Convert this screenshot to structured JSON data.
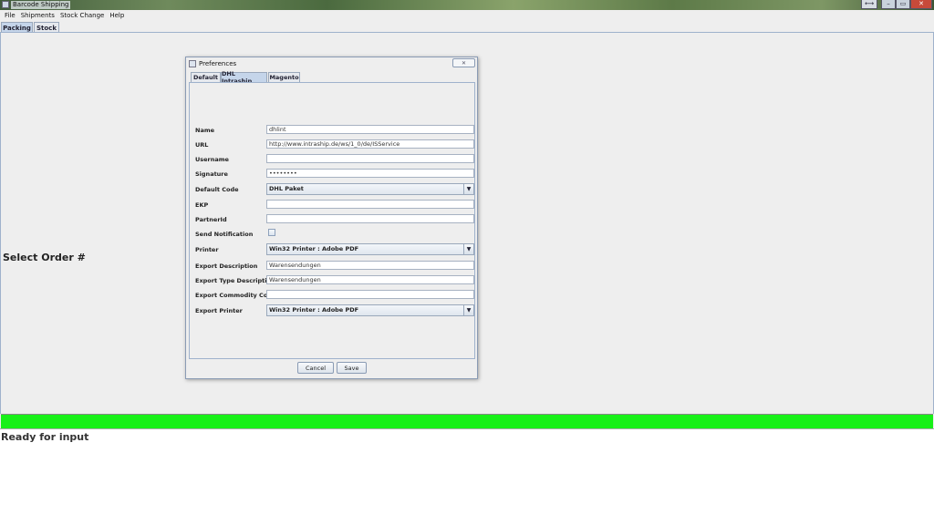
{
  "window": {
    "title": "Barcode Shipping",
    "controls": {
      "resize": "⟷",
      "minimize": "–",
      "maximize": "▭",
      "close": "✕"
    }
  },
  "menu": {
    "items": [
      "File",
      "Shipments",
      "Stock Change",
      "Help"
    ]
  },
  "tabs": {
    "packing": "Packing",
    "stock": "Stock"
  },
  "main": {
    "select_order_label": "Select Order #"
  },
  "status": {
    "text": "Ready for input",
    "color": "#18f018"
  },
  "dialog": {
    "title": "Preferences",
    "close_glyph": "✕",
    "tabs": {
      "default": "Default",
      "dhl": "DHL Intraship",
      "magento": "Magento"
    },
    "fields": {
      "name": {
        "label": "Name",
        "value": "dhlint"
      },
      "url": {
        "label": "URL",
        "value": "http://www.intraship.de/ws/1_0/de/ISService"
      },
      "username": {
        "label": "Username",
        "value": ""
      },
      "signature": {
        "label": "Signature",
        "value": "••••••••"
      },
      "default_code": {
        "label": "Default Code",
        "value": "DHL Paket"
      },
      "ekp": {
        "label": "EKP",
        "value": ""
      },
      "partnerid": {
        "label": "PartnerId",
        "value": ""
      },
      "send_notification": {
        "label": "Send Notification",
        "checked": false
      },
      "printer": {
        "label": "Printer",
        "value": "Win32 Printer : Adobe PDF"
      },
      "export_description": {
        "label": "Export Description",
        "value": "Warensendungen"
      },
      "export_type_description": {
        "label": "Export Type Description",
        "value": "Warensendungen"
      },
      "export_commodity_code": {
        "label": "Export Commodity Code",
        "value": ""
      },
      "export_printer": {
        "label": "Export Printer",
        "value": "Win32 Printer : Adobe PDF"
      }
    },
    "buttons": {
      "cancel": "Cancel",
      "save": "Save"
    }
  }
}
